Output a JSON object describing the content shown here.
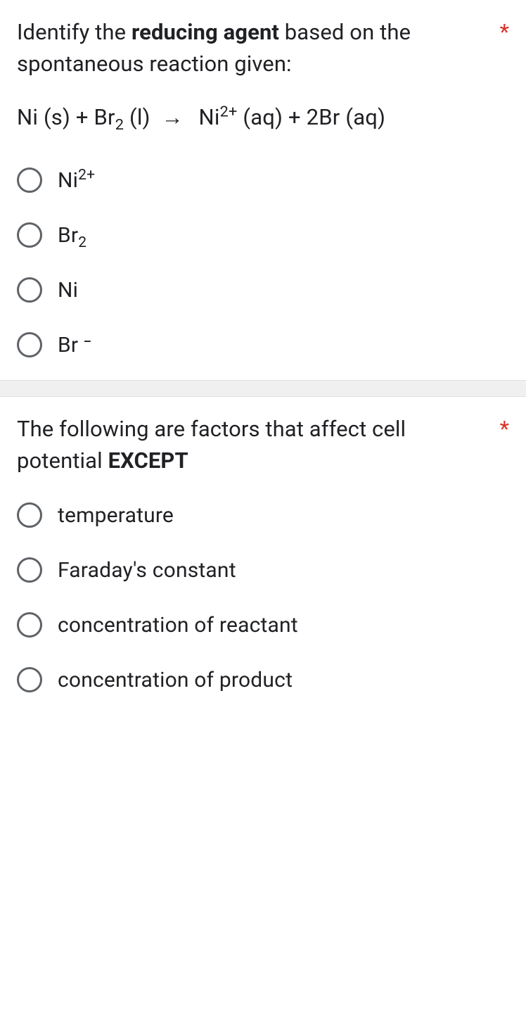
{
  "questions": [
    {
      "text_parts": [
        "Identify the ",
        "reducing agent",
        " based on the spontaneous reaction given:"
      ],
      "bold_index": 1,
      "required": "*",
      "equation": {
        "lhs1": "Ni (s) + Br",
        "sub1": "2",
        "lhs2": " (l)",
        "arrow": "→",
        "rhs1": "Ni",
        "sup1": "2+",
        "rhs2": " (aq) + 2Br ",
        "sup2": "⁻",
        "rhs3": "(aq)"
      },
      "options": [
        {
          "text": "Ni",
          "sup": "2+",
          "sub": ""
        },
        {
          "text": "Br",
          "sup": "",
          "sub": "2"
        },
        {
          "text": "Ni",
          "sup": "",
          "sub": ""
        },
        {
          "text": "Br ⁻",
          "sup": "",
          "sub": ""
        }
      ]
    },
    {
      "text_parts": [
        "The following are factors that affect cell potential ",
        "EXCEPT",
        ""
      ],
      "bold_index": 1,
      "required": "*",
      "options": [
        {
          "text": "temperature",
          "sup": "",
          "sub": ""
        },
        {
          "text": "Faraday's constant",
          "sup": "",
          "sub": ""
        },
        {
          "text": "concentration of reactant",
          "sup": "",
          "sub": ""
        },
        {
          "text": "concentration of product",
          "sup": "",
          "sub": ""
        }
      ]
    }
  ]
}
